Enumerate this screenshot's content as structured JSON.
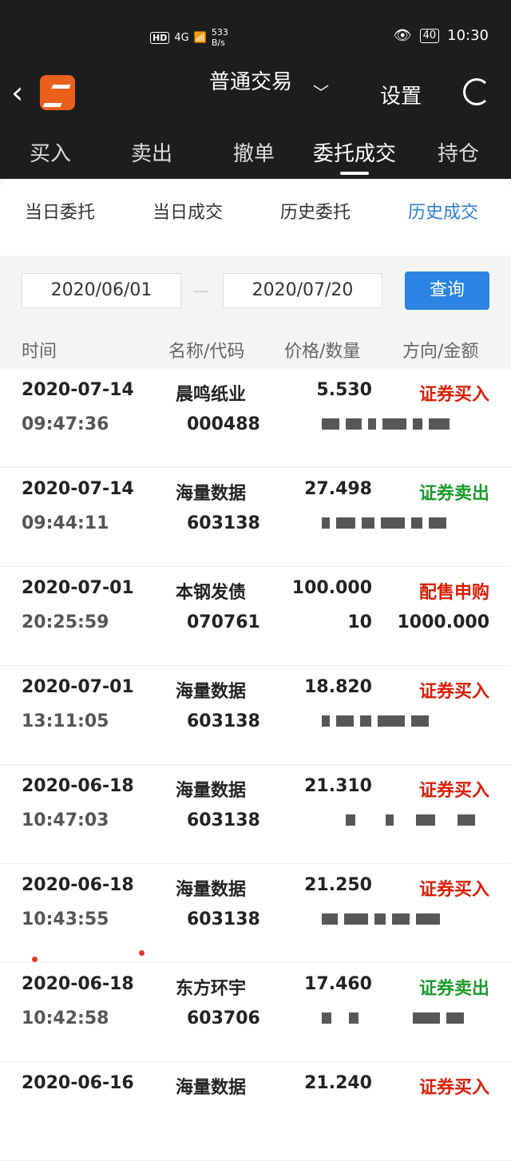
{
  "status": {
    "net_speed": "533",
    "net_unit": "B/s",
    "battery": "40",
    "time": "10:30",
    "hd": "HD",
    "signal": "4G"
  },
  "appbar": {
    "title": "普通交易",
    "settings_label": "设置"
  },
  "tabs": [
    {
      "label": "买入"
    },
    {
      "label": "卖出"
    },
    {
      "label": "撤单"
    },
    {
      "label": "委托成交"
    },
    {
      "label": "持仓"
    }
  ],
  "subtabs": [
    {
      "label": "当日委托"
    },
    {
      "label": "当日成交"
    },
    {
      "label": "历史委托"
    },
    {
      "label": "历史成交"
    }
  ],
  "filter": {
    "start_date": "2020/06/01",
    "end_date": "2020/07/20",
    "separator": "—",
    "query_label": "查询"
  },
  "columns": {
    "time": "时间",
    "name_code": "名称/代码",
    "price_qty": "价格/数量",
    "dir_amount": "方向/金额"
  },
  "rows": [
    {
      "date": "2020-07-14",
      "time": "09:47:36",
      "name": "晨鸣纸业",
      "code": "000488",
      "price": "5.530",
      "qty": "",
      "direction": "证券买入",
      "dir_color": "#d81e06",
      "amount": ""
    },
    {
      "date": "2020-07-14",
      "time": "09:44:11",
      "name": "海量数据",
      "code": "603138",
      "price": "27.498",
      "qty": "",
      "direction": "证券卖出",
      "dir_color": "#1a9b2c",
      "amount": ""
    },
    {
      "date": "2020-07-01",
      "time": "20:25:59",
      "name": "本钢发债",
      "code": "070761",
      "price": "100.000",
      "qty": "10",
      "direction": "配售申购",
      "dir_color": "#d81e06",
      "amount": "1000.000"
    },
    {
      "date": "2020-07-01",
      "time": "13:11:05",
      "name": "海量数据",
      "code": "603138",
      "price": "18.820",
      "qty": "",
      "direction": "证券买入",
      "dir_color": "#d81e06",
      "amount": ""
    },
    {
      "date": "2020-06-18",
      "time": "10:47:03",
      "name": "海量数据",
      "code": "603138",
      "price": "21.310",
      "qty": "",
      "direction": "证券买入",
      "dir_color": "#d81e06",
      "amount": ""
    },
    {
      "date": "2020-06-18",
      "time": "10:43:55",
      "name": "海量数据",
      "code": "603138",
      "price": "21.250",
      "qty": "",
      "direction": "证券买入",
      "dir_color": "#d81e06",
      "amount": ""
    },
    {
      "date": "2020-06-18",
      "time": "10:42:58",
      "name": "东方环宇",
      "code": "603706",
      "price": "17.460",
      "qty": "",
      "direction": "证券卖出",
      "dir_color": "#1a9b2c",
      "amount": ""
    },
    {
      "date": "2020-06-16",
      "time": "",
      "name": "海量数据",
      "code": "",
      "price": "21.240",
      "qty": "",
      "direction": "证券买入",
      "dir_color": "#d81e06",
      "amount": ""
    }
  ]
}
